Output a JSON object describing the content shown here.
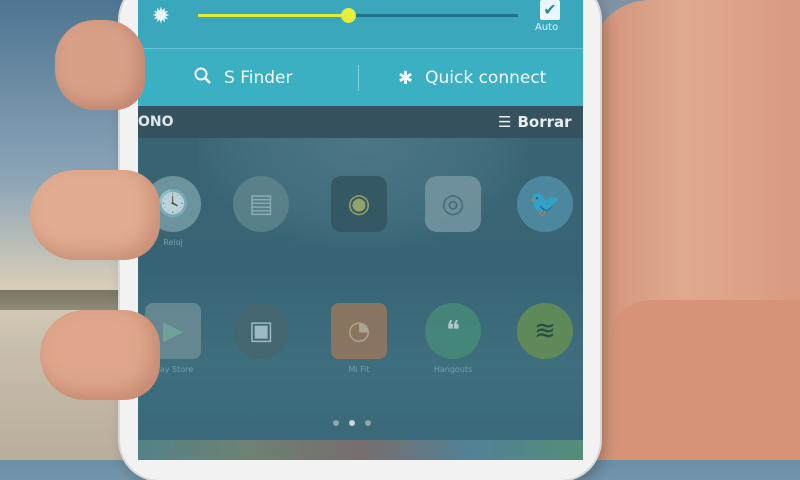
{
  "quick_settings": {
    "brightness_icon": "brightness-auto-icon",
    "brightness_level": 0.47,
    "auto": {
      "label": "Auto",
      "checked": true,
      "check_glyph": "✔"
    },
    "s_finder": {
      "label": "S Finder",
      "icon": "search-icon"
    },
    "quick_connect": {
      "label": "Quick connect",
      "icon": "asterisk-icon"
    }
  },
  "notification_row": {
    "carrier": "ONO",
    "clear_label": "Borrar"
  },
  "home_screen": {
    "apps_row1": [
      {
        "name": "clock",
        "label": "Reloj",
        "icon": "clock-icon"
      },
      {
        "name": "google-folder",
        "label": "",
        "icon": "google-folder-icon"
      },
      {
        "name": "location",
        "label": "",
        "icon": "location-icon"
      },
      {
        "name": "camera",
        "label": "",
        "icon": "camera-icon"
      },
      {
        "name": "twitter-folder",
        "label": "",
        "icon": "twitter-icon"
      }
    ],
    "apps_row2": [
      {
        "name": "play-store",
        "label": "Play Store",
        "icon": "play-store-icon"
      },
      {
        "name": "files",
        "label": "",
        "icon": "files-icon"
      },
      {
        "name": "mi-fit",
        "label": "Mi Fit",
        "icon": "mi-fit-icon"
      },
      {
        "name": "hangouts",
        "label": "Hangouts",
        "icon": "hangouts-icon"
      },
      {
        "name": "spotify",
        "label": "",
        "icon": "spotify-icon"
      }
    ],
    "page_count": 3,
    "active_page": 2
  },
  "colors": {
    "accent": "#3cb0c3",
    "slider": "#e6ef3c"
  }
}
